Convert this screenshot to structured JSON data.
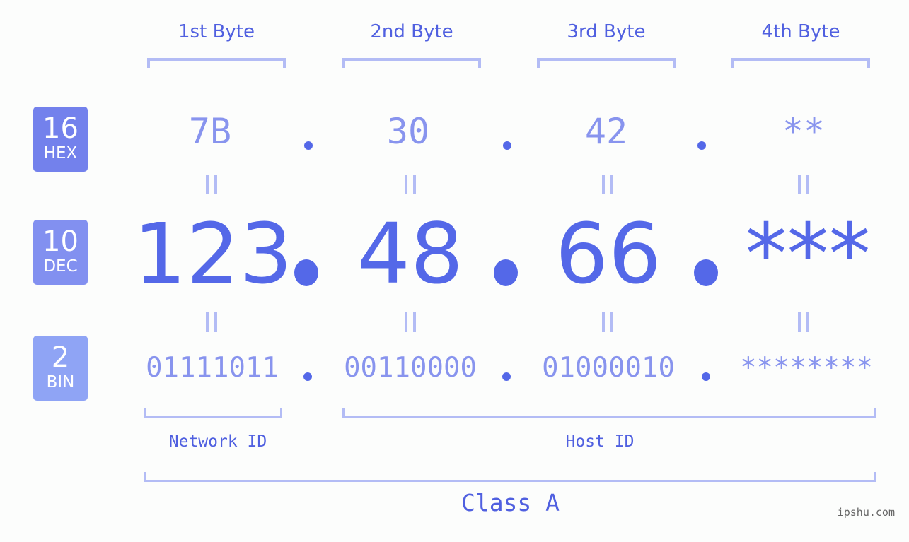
{
  "byte_headers": [
    "1st Byte",
    "2nd Byte",
    "3rd Byte",
    "4th Byte"
  ],
  "badges": {
    "hex": {
      "number": "16",
      "label": "HEX",
      "color": "#7381ec"
    },
    "dec": {
      "number": "10",
      "label": "DEC",
      "color": "#8290f0"
    },
    "bin": {
      "number": "2",
      "label": "BIN",
      "color": "#8fa4f5"
    }
  },
  "hex_values": [
    "7B",
    "30",
    "42",
    "**"
  ],
  "dec_values": [
    "123",
    "48",
    "66",
    "***"
  ],
  "bin_values": [
    "01111011",
    "00110000",
    "01000010",
    "********"
  ],
  "separator": ".",
  "network_id_label": "Network ID",
  "host_id_label": "Host ID",
  "class_label": "Class A",
  "watermark": "ipshu.com",
  "colors": {
    "accent": "#5468e8",
    "light_accent": "#8894ee",
    "bracket": "#b3bcf5",
    "background": "#fcfdfc"
  }
}
